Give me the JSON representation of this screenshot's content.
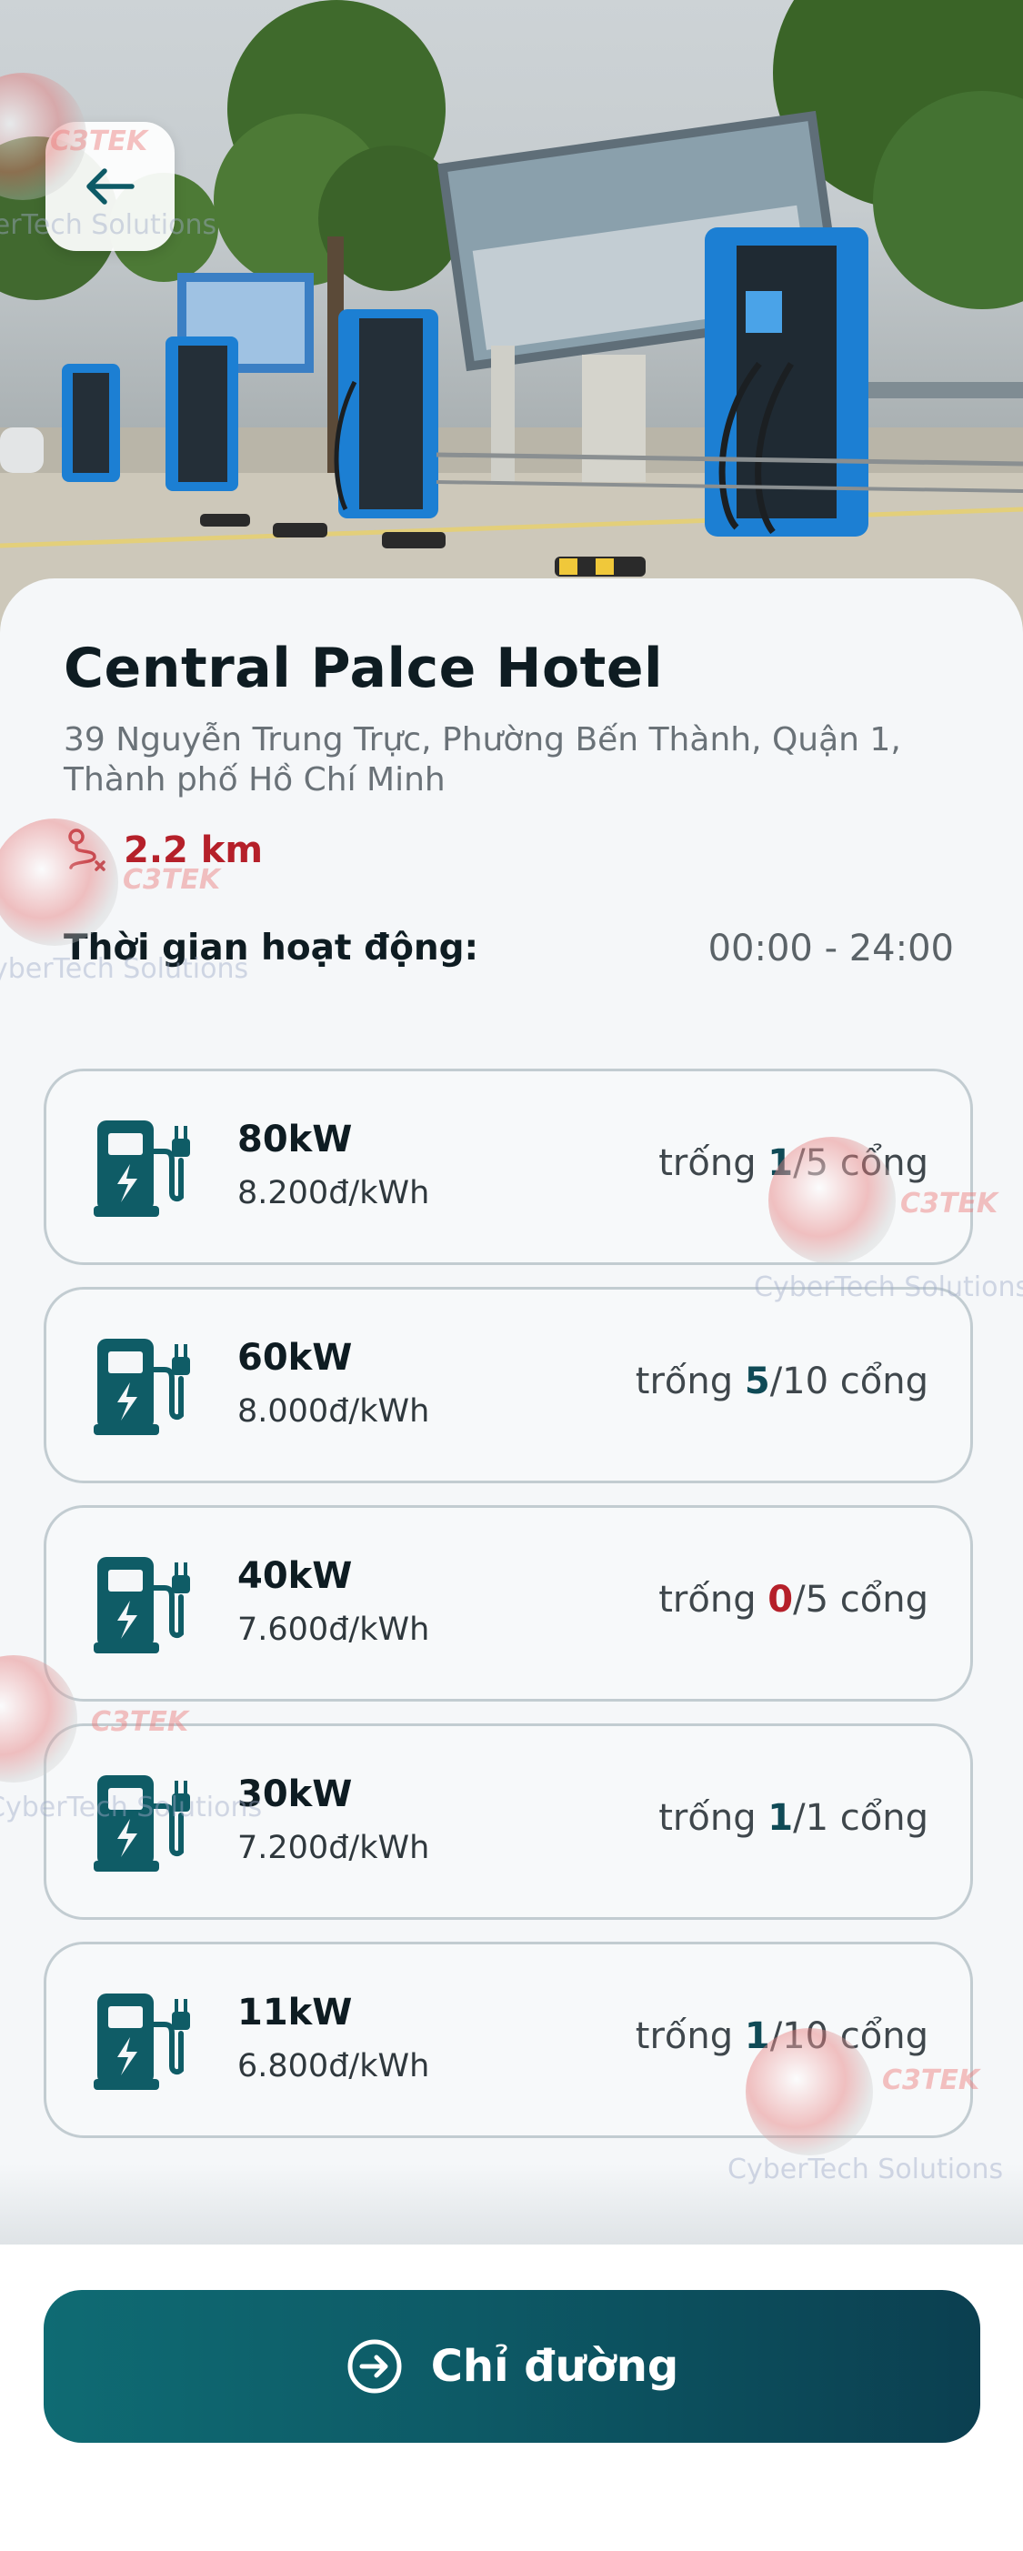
{
  "station": {
    "name": "Central Palce Hotel",
    "address": "39 Nguyễn Trung Trực, Phường Bến Thành, Quận 1, Thành phố Hồ Chí Minh",
    "distance": "2.2 km",
    "hours_label": "Thời gian hoạt động:",
    "hours_value": "00:00 - 24:00"
  },
  "chargers": [
    {
      "power": "80kW",
      "price": "8.200đ/kWh",
      "avail_prefix": "trống ",
      "available": "1",
      "avail_suffix": "/5 cổng",
      "zero": false
    },
    {
      "power": "60kW",
      "price": "8.000đ/kWh",
      "avail_prefix": "trống ",
      "available": "5",
      "avail_suffix": "/10 cổng",
      "zero": false
    },
    {
      "power": "40kW",
      "price": "7.600đ/kWh",
      "avail_prefix": "trống ",
      "available": "0",
      "avail_suffix": "/5 cổng",
      "zero": true
    },
    {
      "power": "30kW",
      "price": "7.200đ/kWh",
      "avail_prefix": "trống ",
      "available": "1",
      "avail_suffix": "/1 cổng",
      "zero": false
    },
    {
      "power": "11kW",
      "price": "6.800đ/kWh",
      "avail_prefix": "trống ",
      "available": "1",
      "avail_suffix": "/10 cổng",
      "zero": false
    }
  ],
  "actions": {
    "directions_label": "Chỉ đường"
  },
  "watermark": {
    "brand": "C3TEK",
    "sub_cyber": "Cyber",
    "sub_tech": "Tech",
    "sub_rest": " Solutions"
  },
  "colors": {
    "primary": "#0d5a66",
    "accent_red": "#b5202a",
    "card_border": "#c2ccd1"
  },
  "icons": {
    "back": "arrow-left-icon",
    "route": "route-icon",
    "charger": "ev-charger-icon",
    "directions": "arrow-right-circle-icon"
  }
}
